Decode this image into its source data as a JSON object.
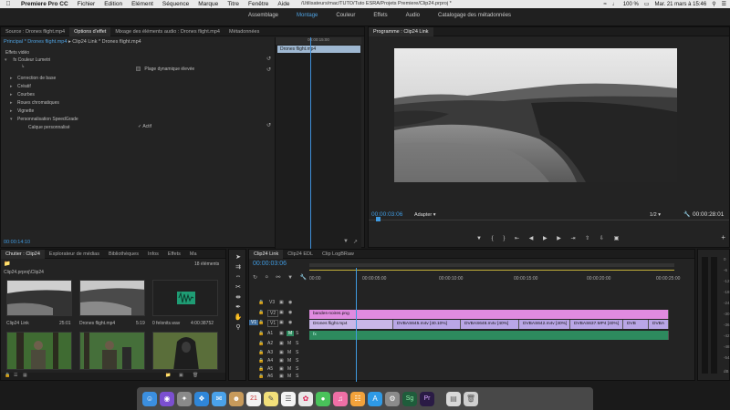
{
  "menubar": {
    "app": "Premiere Pro CC",
    "items": [
      "Fichier",
      "Edition",
      "Elément",
      "Séquence",
      "Marque",
      "Titre",
      "Fenêtre",
      "Aide"
    ],
    "path": "/Utilisateurs/mac/TUTO/Tuto ESRA/Projets Premiere/Clip24.prproj *",
    "battery": "100 %",
    "datetime": "Mar. 21 mars à 15:46"
  },
  "workspace": {
    "tabs": [
      "Assemblage",
      "Montage",
      "Couleur",
      "Effets",
      "Audio",
      "Catalogage des métadonnées"
    ]
  },
  "effect_panel": {
    "tabs": [
      "Source : Drones flight.mp4",
      "Options d'effet",
      "Mixage des éléments audio : Drones flight.mp4",
      "Métadonnées"
    ],
    "header_main": "Principal * Drones flight.mp4",
    "header_link": "Clip24 Link * Drones flight.mp4",
    "section": "Effets vidéo",
    "effect_name": "Couleur Lumetri",
    "hdr_label": "Plage dynamique élevée",
    "rows": [
      "Correction de base",
      "Créatif",
      "Courbes",
      "Roues chromatiques",
      "Vignette",
      "Personnalisation SpeedGrade"
    ],
    "calque_label": "Calque personnalisé",
    "actif_label": "Actif",
    "ruler_time": "00:00:15:00",
    "clip_name": "Drones flight.mp4",
    "timecode": "00:00:14:10"
  },
  "program": {
    "title": "Programme : Clip24 Link",
    "timecode": "00:00:03:06",
    "fit": "Adapter",
    "quality": "1/2",
    "duration": "00:00:28:01"
  },
  "project": {
    "tabs": [
      "Chutier : Clip24",
      "Explorateur de médias",
      "Bibliothèques",
      "Infos",
      "Effets",
      "Ma"
    ],
    "path": "Clip24.prproj\\Clip24",
    "count": "18 éléments",
    "items": [
      {
        "name": "Clip24 Link",
        "dur": "25:01"
      },
      {
        "name": "Drones flight.mp4",
        "dur": "5:19"
      },
      {
        "name": "0 felonits.wav",
        "dur": "4:00:38752"
      }
    ]
  },
  "timeline": {
    "tabs": [
      "Clip24 Link",
      "Clip24 EDL",
      "Clip LogBRaw"
    ],
    "timecode": "00:00:03:06",
    "ruler": [
      "00:00",
      "00:00:05:00",
      "00:00:10:00",
      "00:00:15:00",
      "00:00:20:00",
      "00:00:25:00"
    ],
    "video_tracks": [
      "V3",
      "V2",
      "V1"
    ],
    "audio_tracks": [
      "A1",
      "A2",
      "A3",
      "A4",
      "A5",
      "A6"
    ],
    "v2_clip": "bandes-noires.png",
    "v1_clips": [
      "Drones flight.mp4",
      "DVBAS645.m4v [40.10%]",
      "DVBAS648.m4v [40%]",
      "DVBAS642.m4v [40%]",
      "DVBAS637.MP4 [40%]",
      "DVB",
      "DVBA"
    ]
  },
  "meter": {
    "labels": [
      "0",
      "-6",
      "-12",
      "-18",
      "-24",
      "-30",
      "-36",
      "-42",
      "-48",
      "-54",
      "dB"
    ]
  },
  "dock": {
    "icons": [
      "finder",
      "siri",
      "launchpad",
      "safari",
      "mail",
      "contacts",
      "calendar",
      "notes",
      "reminders",
      "photos",
      "messages",
      "itunes",
      "ibooks",
      "appstore",
      "preferences",
      "speedgrade",
      "premiere",
      "trash"
    ],
    "calendar_day": "21"
  },
  "colors": {
    "accent": "#3f9ae0",
    "v2_clip": "#e08be0",
    "v1_clip": "#b9a6e6",
    "audio_clip": "#2d8a5e",
    "workarea": "#c6b23a"
  }
}
